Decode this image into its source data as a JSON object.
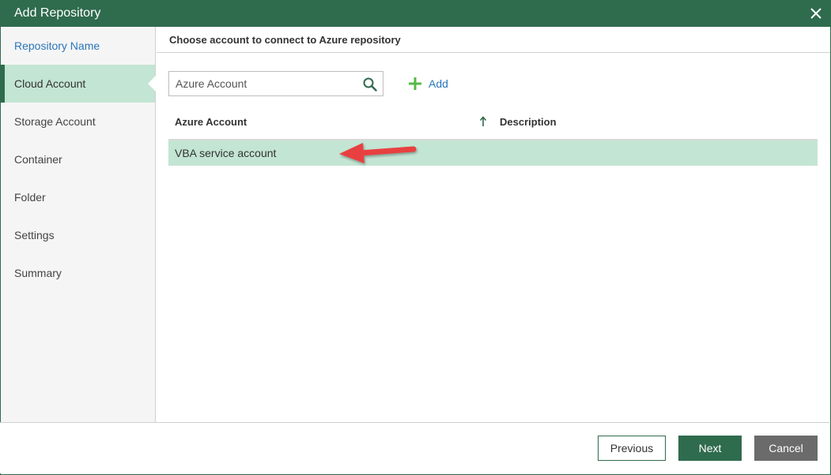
{
  "window": {
    "title": "Add Repository",
    "close_icon": "close-icon"
  },
  "sidebar": {
    "items": [
      {
        "label": "Repository Name",
        "state": "link"
      },
      {
        "label": "Cloud Account",
        "state": "active"
      },
      {
        "label": "Storage Account",
        "state": "normal"
      },
      {
        "label": "Container",
        "state": "normal"
      },
      {
        "label": "Folder",
        "state": "normal"
      },
      {
        "label": "Settings",
        "state": "normal"
      },
      {
        "label": "Summary",
        "state": "normal"
      }
    ]
  },
  "main": {
    "heading": "Choose account to connect to Azure repository",
    "search": {
      "placeholder": "Azure Account",
      "value": "",
      "icon": "search-icon"
    },
    "add_button": {
      "label": "Add",
      "icon": "plus-icon"
    },
    "table": {
      "columns": [
        "Azure Account",
        "Description"
      ],
      "sort_icon": "arrow-up-icon",
      "rows": [
        {
          "account": "VBA service account",
          "description": "",
          "selected": true
        }
      ]
    },
    "annotation_icon": "red-arrow-icon"
  },
  "footer": {
    "previous_label": "Previous",
    "next_label": "Next",
    "cancel_label": "Cancel"
  },
  "colors": {
    "brand_green": "#2f6b4d",
    "selection_green": "#c3e5d3",
    "link_blue": "#2b76b9",
    "add_plus_green": "#54b948",
    "annotation_red": "#e8413f",
    "cancel_gray": "#6b6b6b"
  }
}
